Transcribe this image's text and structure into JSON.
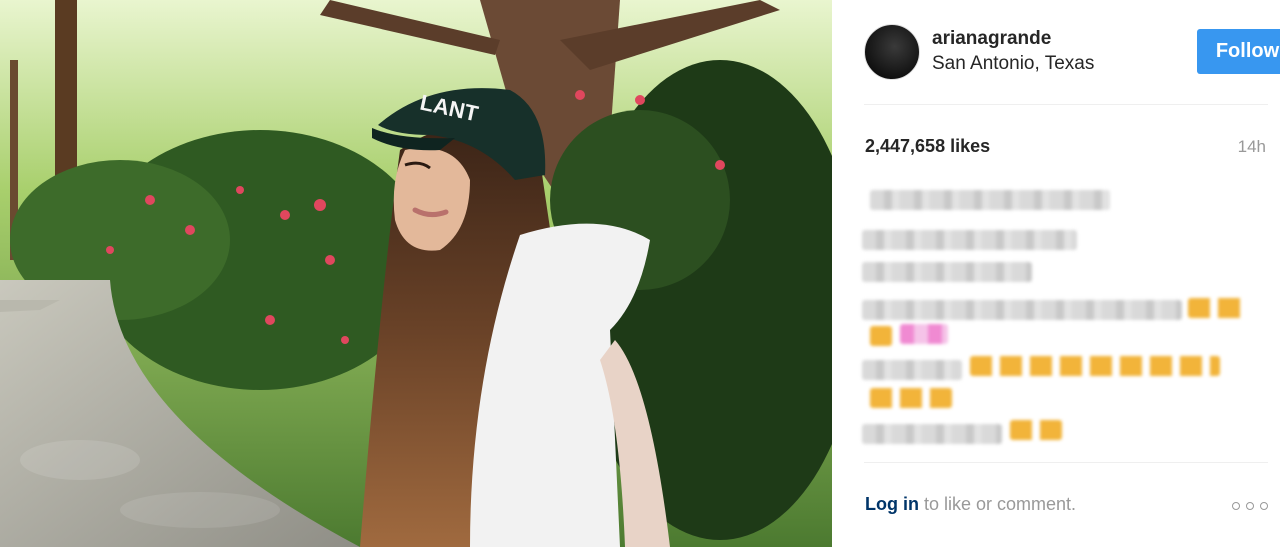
{
  "post": {
    "username": "arianagrande",
    "location": "San Antonio, Texas",
    "follow_label": "Follow",
    "likes": "2,447,658 likes",
    "timestamp": "14h",
    "cap_text": "LANT"
  },
  "footer": {
    "login_label": "Log in",
    "rest_label": " to like or comment."
  },
  "icons": {
    "more": "more-options-icon"
  },
  "colors": {
    "accent": "#3897f0",
    "link": "#003569",
    "muted": "#999999"
  }
}
